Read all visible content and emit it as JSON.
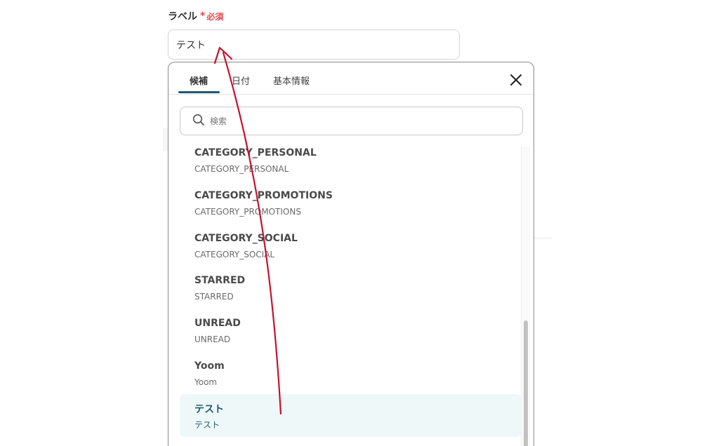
{
  "field": {
    "label": "ラベル",
    "required_mark": "*",
    "required_text": "必須",
    "value": "テスト"
  },
  "popup": {
    "tabs": [
      {
        "label": "候補",
        "active": true
      },
      {
        "label": "日付",
        "active": false
      },
      {
        "label": "基本情報",
        "active": false
      }
    ],
    "close_icon": "close-icon",
    "search": {
      "icon": "search-icon",
      "placeholder": "検索",
      "value": ""
    },
    "items": [
      {
        "title": "CATEGORY_PERSONAL",
        "subtitle": "CATEGORY_PERSONAL",
        "selected": false
      },
      {
        "title": "CATEGORY_PROMOTIONS",
        "subtitle": "CATEGORY_PROMOTIONS",
        "selected": false
      },
      {
        "title": "CATEGORY_SOCIAL",
        "subtitle": "CATEGORY_SOCIAL",
        "selected": false
      },
      {
        "title": "STARRED",
        "subtitle": "STARRED",
        "selected": false
      },
      {
        "title": "UNREAD",
        "subtitle": "UNREAD",
        "selected": false
      },
      {
        "title": "Yoom",
        "subtitle": "Yoom",
        "selected": false
      },
      {
        "title": "テスト",
        "subtitle": "テスト",
        "selected": true
      }
    ]
  },
  "colors": {
    "accent": "#1f5a6e",
    "required": "#e2494a",
    "selected_bg": "#eef8f8",
    "annotation_arrow": "#c8102e"
  }
}
